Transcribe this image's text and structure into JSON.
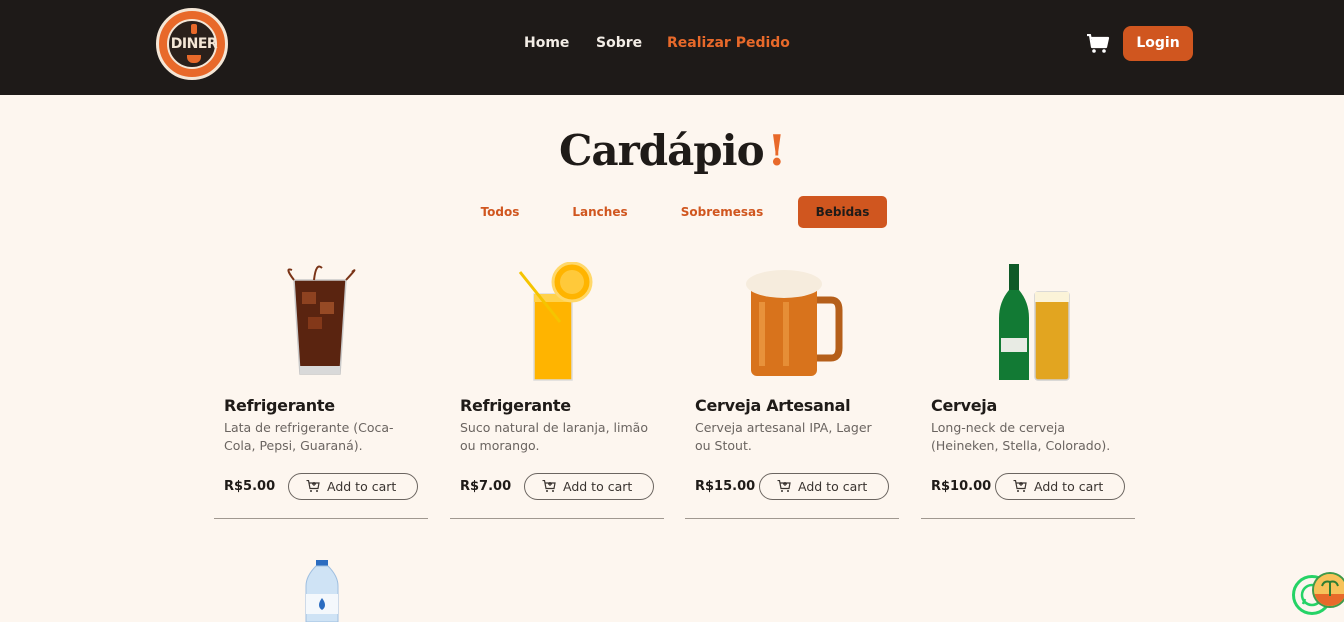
{
  "header": {
    "logo_text": "DINER",
    "nav": {
      "home": "Home",
      "sobre": "Sobre",
      "pedido": "Realizar Pedido"
    },
    "login": "Login"
  },
  "title": {
    "main": "Cardápio",
    "accent": "!"
  },
  "tabs": [
    "Todos",
    "Lanches",
    "Sobremesas",
    "Bebidas"
  ],
  "active_tab": "Bebidas",
  "products": [
    {
      "name": "Refrigerante",
      "desc": "Lata de refrigerante (Coca-Cola, Pepsi, Guaraná).",
      "price": "R$5.00",
      "cta": "Add to cart",
      "image": "cola-glass"
    },
    {
      "name": "Refrigerante",
      "desc": "Suco natural de laranja, limão ou morango.",
      "price": "R$7.00",
      "cta": "Add to cart",
      "image": "orange-juice"
    },
    {
      "name": "Cerveja Artesanal",
      "desc": "Cerveja artesanal IPA, Lager ou Stout.",
      "price": "R$15.00",
      "cta": "Add to cart",
      "image": "beer-mug"
    },
    {
      "name": "Cerveja",
      "desc": "Long-neck de cerveja (Heineken, Stella, Colorado).",
      "price": "R$10.00",
      "cta": "Add to cart",
      "image": "beer-bottle"
    },
    {
      "image": "water-bottle"
    }
  ],
  "colors": {
    "accent": "#e8692a",
    "button": "#d0561f",
    "header_bg": "#1e1a18",
    "page_bg": "#fdf6ef"
  }
}
